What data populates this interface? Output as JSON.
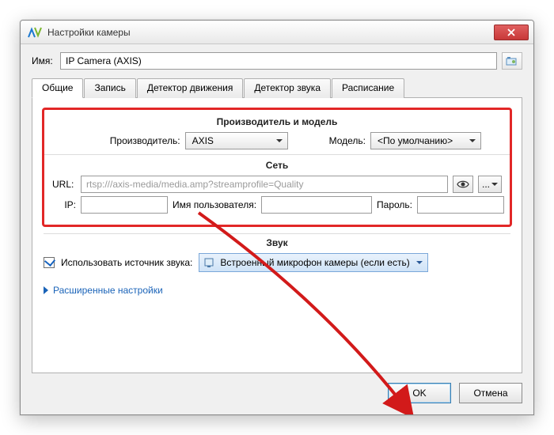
{
  "window": {
    "title": "Настройки камеры"
  },
  "name": {
    "label": "Имя:",
    "value": "IP Camera (AXIS)"
  },
  "tabs": {
    "general": "Общие",
    "recording": "Запись",
    "motion": "Детектор движения",
    "sound_det": "Детектор звука",
    "schedule": "Расписание"
  },
  "sections": {
    "manufacturer_model": "Производитель и модель",
    "manufacturer_label": "Производитель:",
    "manufacturer_value": "AXIS",
    "model_label": "Модель:",
    "model_value": "<По умолчанию>",
    "network": "Сеть",
    "url_label": "URL:",
    "url_value": "rtsp:///axis-media/media.amp?streamprofile=Quality",
    "ip_label": "IP:",
    "username_label": "Имя пользователя:",
    "password_label": "Пароль:",
    "sound": "Звук",
    "use_sound_source": "Использовать источник звука:",
    "sound_source_value": "Встроенный микрофон камеры (если есть)",
    "advanced": "Расширенные настройки",
    "browse": "..."
  },
  "buttons": {
    "ok": "OK",
    "cancel": "Отмена"
  }
}
